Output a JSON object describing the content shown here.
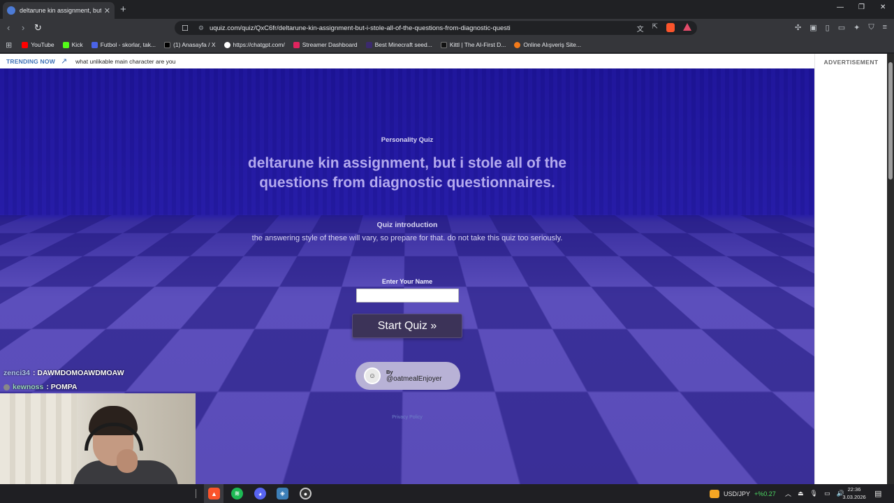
{
  "browser": {
    "tab_title": "deltarune kin assignment, but i s",
    "tab_close": "✕",
    "new_tab": "+",
    "url": "uquiz.com/quiz/QxC6fr/deltarune-kin-assignment-but-i-stole-all-of-the-questions-from-diagnostic-questi",
    "window_minimize": "—",
    "window_restore": "❐",
    "window_close": "✕",
    "nav_back": "‹",
    "nav_forward": "›",
    "nav_reload": "↻"
  },
  "bookmarks": [
    {
      "label": "YouTube",
      "color": "#ff0000"
    },
    {
      "label": "Kick",
      "color": "#53fc18"
    },
    {
      "label": "Futbol - skorlar, tak...",
      "color": "#4a63e8"
    },
    {
      "label": "(1) Anasayfa / X",
      "color": "#000000"
    },
    {
      "label": "https://chatgpt.com/",
      "color": "#ffffff"
    },
    {
      "label": "Streamer Dashboard",
      "color": "#e0245e"
    },
    {
      "label": "Best Minecraft seed...",
      "color": "#3b2a6e"
    },
    {
      "label": "Kittl | The AI-First D...",
      "color": "#111111"
    },
    {
      "label": "Online Alışveriş Site...",
      "color": "#f27a1a"
    }
  ],
  "page": {
    "trending_label": "TRENDING NOW",
    "trending_item": "what unlikable main character are you",
    "advertisement": "ADVERTISEMENT",
    "quiz_type": "Personality Quiz",
    "quiz_title": "deltarune kin assignment, but i stole all of the questions from diagnostic questionnaires.",
    "intro_heading": "Quiz introduction",
    "intro_text": "the answering style of these will vary, so prepare for that. do not take this quiz too seriously.",
    "name_label": "Enter Your Name",
    "name_value": "",
    "start_button": "Start Quiz »",
    "author_by": "By",
    "author_handle": "@oatmealEnjoyer",
    "privacy": "Privacy Policy"
  },
  "chat": [
    {
      "user": "zenci34",
      "user_color": "#b0c8f0",
      "message": ": DAWMDOMOAWDMOAW"
    },
    {
      "user": "kewnoss",
      "user_color": "#9ad8c0",
      "message": ": POMPA"
    }
  ],
  "taskbar": {
    "fx_pair": "USD/JPY",
    "fx_change": "+%0.27",
    "time": "22:36",
    "date": "3.03.2026"
  },
  "colors": {
    "hero_top": "#1d1496",
    "title": "#b4aaee",
    "start_button_bg": "#3c3358"
  }
}
